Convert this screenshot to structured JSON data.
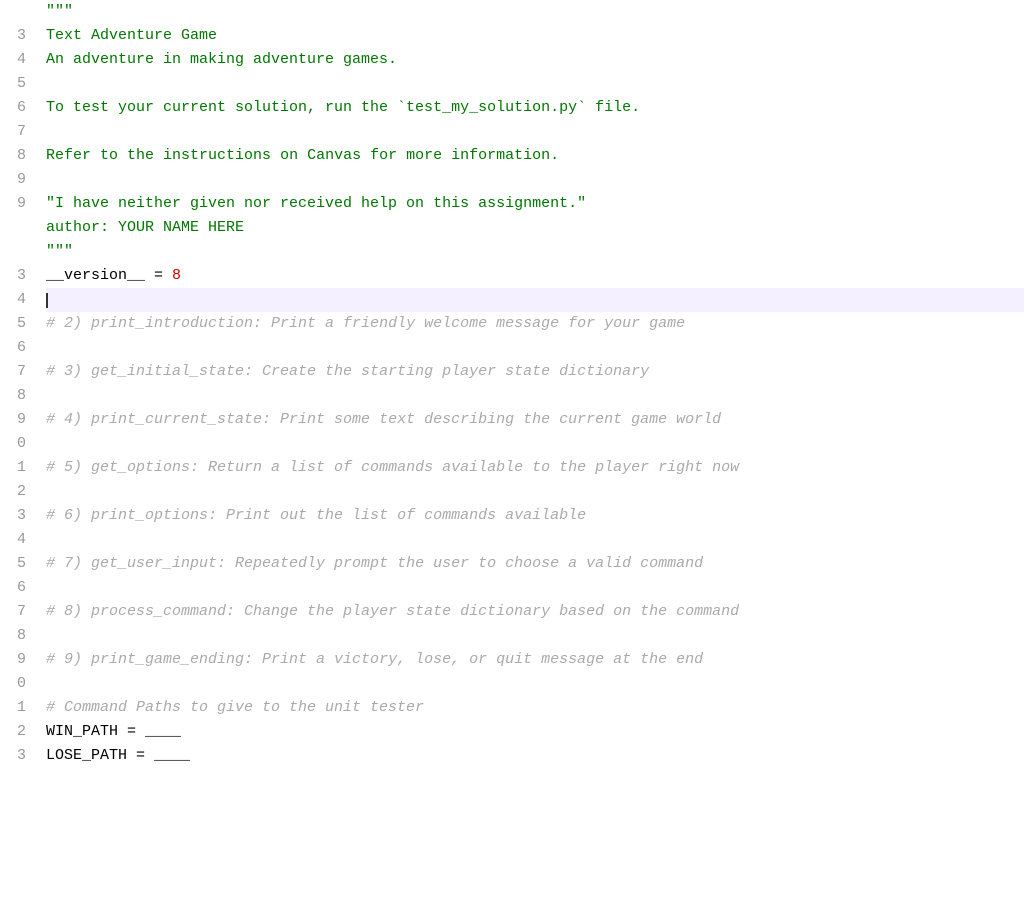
{
  "editor": {
    "lines": [
      {
        "num": "",
        "content": [
          {
            "text": "\"\"\"",
            "class": "green"
          }
        ],
        "highlighted": false
      },
      {
        "num": "3",
        "content": [
          {
            "text": "Text Adventure Game",
            "class": "green"
          }
        ],
        "highlighted": false
      },
      {
        "num": "4",
        "content": [
          {
            "text": "An adventure in making adventure games.",
            "class": "green"
          }
        ],
        "highlighted": false
      },
      {
        "num": "5",
        "content": [],
        "highlighted": false
      },
      {
        "num": "6",
        "content": [
          {
            "text": "To test your current solution, run the `test_my_solution.py` file.",
            "class": "green"
          }
        ],
        "highlighted": false
      },
      {
        "num": "7",
        "content": [],
        "highlighted": false
      },
      {
        "num": "8",
        "content": [
          {
            "text": "Refer to the instructions on Canvas for more information.",
            "class": "green"
          }
        ],
        "highlighted": false
      },
      {
        "num": "9",
        "content": [],
        "highlighted": false
      },
      {
        "num": "9",
        "content": [
          {
            "text": "\"I have neither given nor received help on this assignment.\"",
            "class": "green"
          }
        ],
        "highlighted": false
      },
      {
        "num": "",
        "content": [
          {
            "text": "author: YOUR NAME HERE",
            "class": "green"
          }
        ],
        "highlighted": false
      },
      {
        "num": "",
        "content": [
          {
            "text": "\"\"\"",
            "class": "green"
          }
        ],
        "highlighted": false
      },
      {
        "num": "3",
        "content": [
          {
            "text": "__version__",
            "class": "black"
          },
          {
            "text": " = ",
            "class": "black"
          },
          {
            "text": "8",
            "class": "red"
          }
        ],
        "highlighted": false
      },
      {
        "num": "4",
        "content": [
          {
            "text": "",
            "class": "black"
          },
          {
            "text": "CURSOR",
            "class": "cursor"
          }
        ],
        "highlighted": true
      },
      {
        "num": "5",
        "content": [
          {
            "text": "# 2) print_introduction: Print a friendly welcome message for your game",
            "class": "gray-italic"
          }
        ],
        "highlighted": false
      },
      {
        "num": "6",
        "content": [],
        "highlighted": false
      },
      {
        "num": "7",
        "content": [
          {
            "text": "# 3) get_initial_state: Create the starting player state dictionary",
            "class": "gray-italic"
          }
        ],
        "highlighted": false
      },
      {
        "num": "8",
        "content": [],
        "highlighted": false
      },
      {
        "num": "9",
        "content": [
          {
            "text": "# 4) print_current_state: Print some text describing the current game world",
            "class": "gray-italic"
          }
        ],
        "highlighted": false
      },
      {
        "num": "0",
        "content": [],
        "highlighted": false
      },
      {
        "num": "1",
        "content": [
          {
            "text": "# 5) get_options: Return a list of commands available to the player right now",
            "class": "gray-italic"
          }
        ],
        "highlighted": false
      },
      {
        "num": "2",
        "content": [],
        "highlighted": false
      },
      {
        "num": "3",
        "content": [
          {
            "text": "# 6) print_options: Print out the list of commands available",
            "class": "gray-italic"
          }
        ],
        "highlighted": false
      },
      {
        "num": "4",
        "content": [],
        "highlighted": false
      },
      {
        "num": "5",
        "content": [
          {
            "text": "# 7) get_user_input: Repeatedly prompt the user to choose a valid command",
            "class": "gray-italic"
          }
        ],
        "highlighted": false
      },
      {
        "num": "6",
        "content": [],
        "highlighted": false
      },
      {
        "num": "7",
        "content": [
          {
            "text": "# 8) process_command: Change the player state dictionary based on the command",
            "class": "gray-italic"
          }
        ],
        "highlighted": false
      },
      {
        "num": "8",
        "content": [],
        "highlighted": false
      },
      {
        "num": "9",
        "content": [
          {
            "text": "# 9) print_game_ending: Print a victory, lose, or quit message at the end",
            "class": "gray-italic"
          }
        ],
        "highlighted": false
      },
      {
        "num": "0",
        "content": [],
        "highlighted": false
      },
      {
        "num": "1",
        "content": [
          {
            "text": "# Command Paths to give to the unit tester",
            "class": "gray-italic"
          }
        ],
        "highlighted": false
      },
      {
        "num": "2",
        "content": [
          {
            "text": "WIN_PATH = ____",
            "class": "black"
          }
        ],
        "highlighted": false
      },
      {
        "num": "3",
        "content": [
          {
            "text": "LOSE_PATH = ____",
            "class": "black"
          }
        ],
        "highlighted": false
      }
    ]
  }
}
